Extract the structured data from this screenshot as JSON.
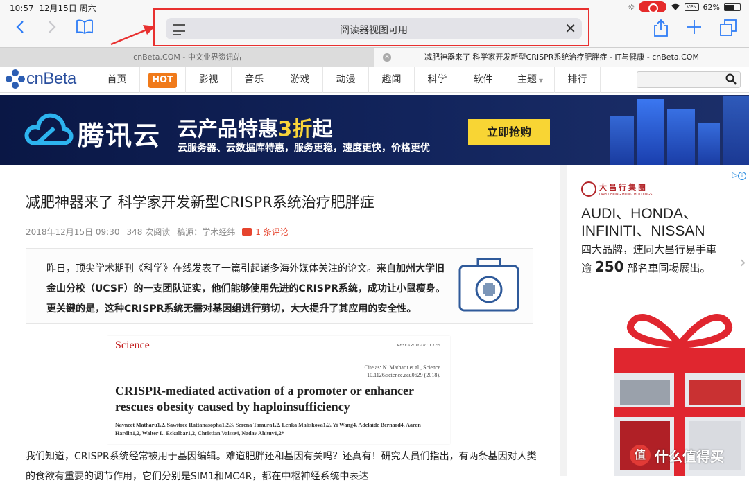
{
  "status_bar": {
    "time": "10:57",
    "date": "12月15日 周六",
    "vpn": "VPN",
    "battery": "62%"
  },
  "toolbar": {
    "address_text": "阅读器视图可用"
  },
  "tabs": [
    {
      "title": "cnBeta.COM - 中文业界资讯站"
    },
    {
      "title": "减肥神器来了 科学家开发新型CRISPR系统治疗肥胖症 - IT与健康 - cnBeta.COM"
    }
  ],
  "site": {
    "logo": "cnBeta",
    "nav": [
      "首页",
      "HOT",
      "影视",
      "音乐",
      "游戏",
      "动漫",
      "趣闻",
      "科学",
      "软件",
      "主题",
      "排行"
    ]
  },
  "banner": {
    "brand": "腾讯云",
    "headline_pre": "云产品特惠",
    "headline_highlight": "3折",
    "headline_post": "起",
    "sub": "云服务器、云数据库特惠，服务更稳，速度更快，价格更优",
    "cta": "立即抢购"
  },
  "article": {
    "title": "减肥神器来了 科学家开发新型CRISPR系统治疗肥胖症",
    "date": "2018年12月15日 09:30",
    "views": "348 次阅读",
    "source": "稿源：学术经纬",
    "comments": "1 条评论",
    "summary_plain": "昨日，顶尖学术期刊《科学》在线发表了一篇引起诸多海外媒体关注的论文。",
    "summary_bold": "来自加州大学旧金山分校（UCSF）的一支团队证实，他们能够使用先进的CRISPR系统，成功让小鼠瘦身。更关键的是，这种CRISPR系统无需对基因组进行剪切，大大提升了其应用的安全性。",
    "paper": {
      "journal": "Science",
      "section": "RESEARCH ARTICLES",
      "cite_line1": "Cite as: N. Matharu et al., Science",
      "cite_line2": "10.1126/science.aau0629 (2018).",
      "title": "CRISPR-mediated activation of a promoter or enhancer rescues obesity caused by haploinsufficiency",
      "authors": "Navneet Matharu1,2, Sawitree Rattanasopha1,2,3, Serena Tamura1,2, Lenka Maliskova1,2, Yi Wang4, Adelaide Bernard4, Aaron Hardin1,2, Walter L. Eckalbar1,2, Christian Vaisse4, Nadav Ahituv1,2*"
    },
    "body": "我们知道，CRISPR系统经常被用于基因编辑。难道肥胖还和基因有关吗？还真有！研究人员们指出，有两条基因对人类的食欲有重要的调节作用，它们分别是SIM1和MC4R，都在中枢神经系统中表达"
  },
  "ad": {
    "company_cn": "大昌行集團",
    "company_en": "DAH CHONG HONG HOLDINGS",
    "brands_line1": "AUDI、HONDA、",
    "brands_line2": "INFINITI、NISSAN",
    "text_line1": "四大品牌，連同大昌行易手車",
    "text_pre": "逾",
    "text_num": "250",
    "text_post": "部名車同場展出。"
  },
  "watermark": {
    "text": "什么值得买",
    "icon": "值"
  }
}
